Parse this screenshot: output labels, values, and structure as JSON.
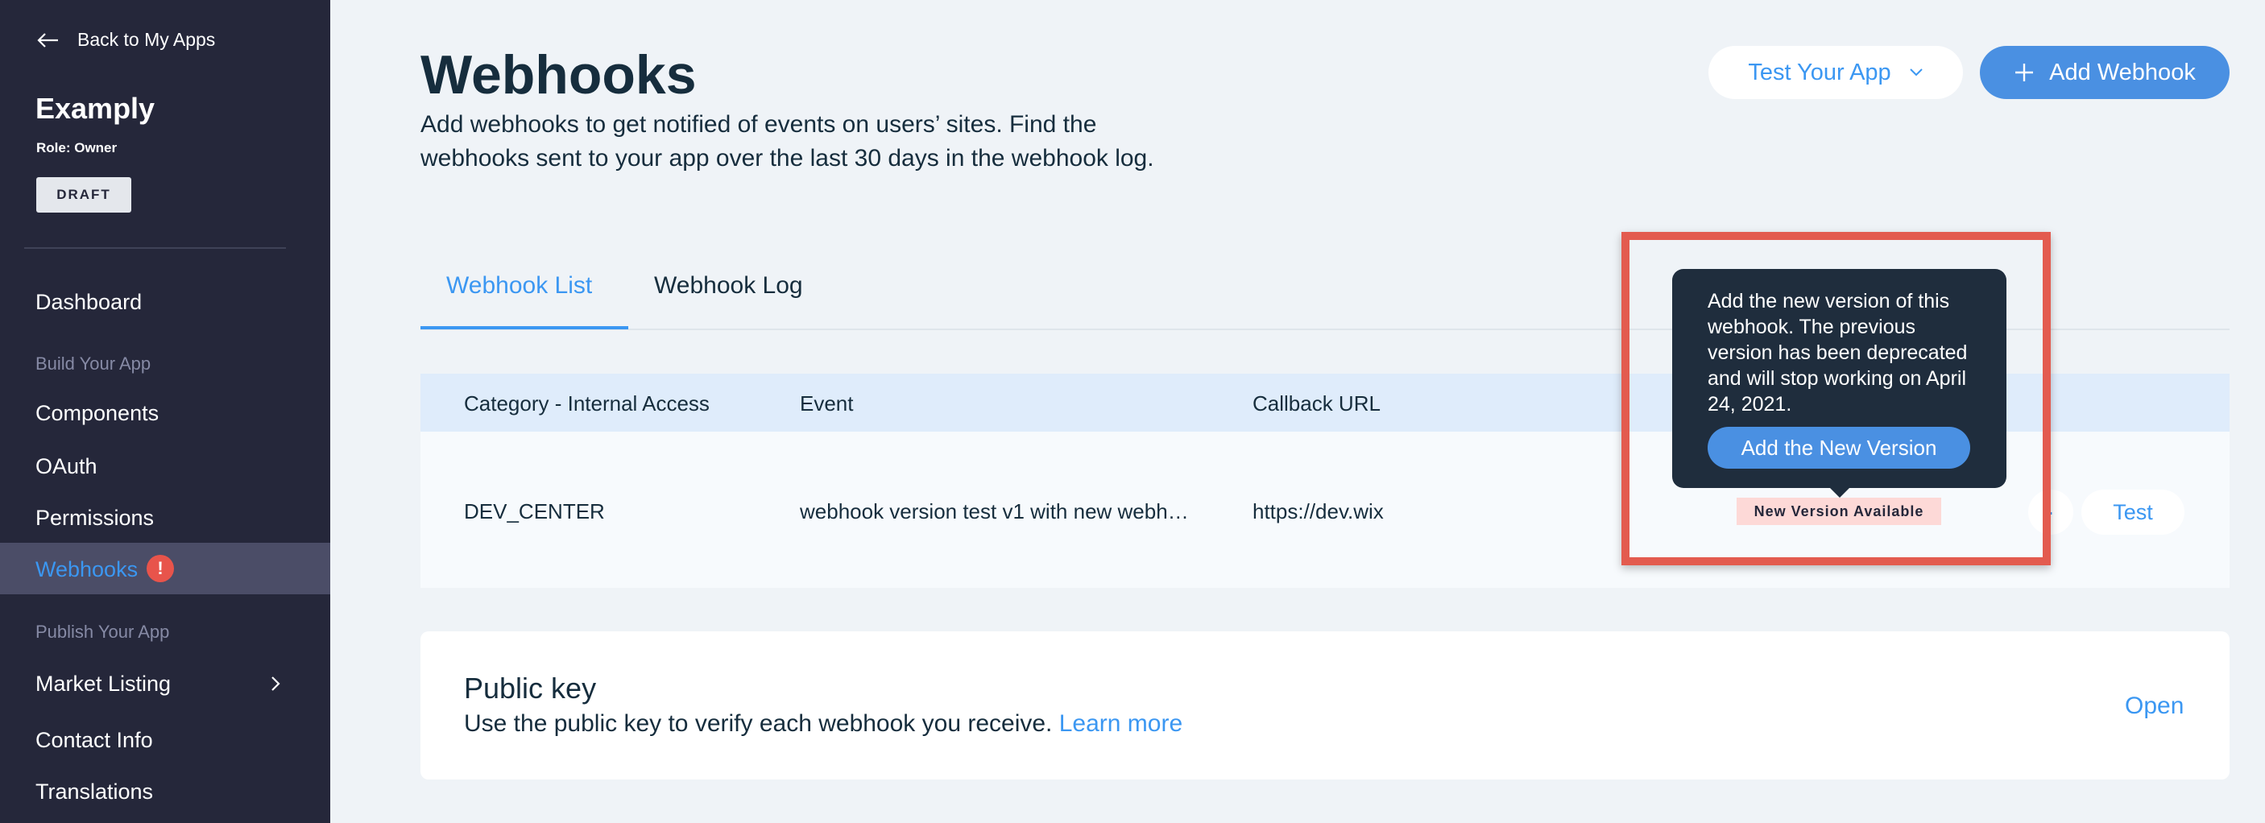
{
  "sidebar": {
    "back_label": "Back to My Apps",
    "app_name": "Examply",
    "role": "Role: Owner",
    "status_badge": "DRAFT",
    "items": {
      "dashboard": "Dashboard",
      "section_build": "Build Your App",
      "components": "Components",
      "oauth": "OAuth",
      "permissions": "Permissions",
      "webhooks": "Webhooks",
      "webhooks_alert": "!",
      "section_publish": "Publish Your App",
      "market_listing": "Market Listing",
      "contact_info": "Contact Info",
      "translations": "Translations"
    }
  },
  "header": {
    "title": "Webhooks",
    "description": "Add webhooks to get notified of events on users’ sites. Find the webhooks sent to your app over the last 30 days in the webhook log.",
    "test_app_label": "Test Your App",
    "add_webhook_label": "Add Webhook"
  },
  "tabs": {
    "list": "Webhook List",
    "log": "Webhook Log"
  },
  "table": {
    "columns": [
      "Category - Internal Access",
      "Event",
      "Callback URL"
    ],
    "row": {
      "category": "DEV_CENTER",
      "event": "webhook version test v1 with new webh…",
      "callback": "https://dev.wix",
      "badge": "New Version Available",
      "test_label": "Test"
    }
  },
  "tooltip": {
    "text": "Add the new version of this webhook. The previous version has been deprecated and will stop working on April 24, 2021.",
    "button": "Add the New Version"
  },
  "public_key": {
    "title": "Public key",
    "description": "Use the public key to verify each webhook you receive.",
    "learn_more": "Learn more",
    "open": "Open"
  },
  "colors": {
    "sidebar_bg": "#25273a",
    "accent": "#3b97f2",
    "primary_button": "#4a90e2",
    "alert": "#e8544b",
    "highlight": "#e35b4f"
  }
}
